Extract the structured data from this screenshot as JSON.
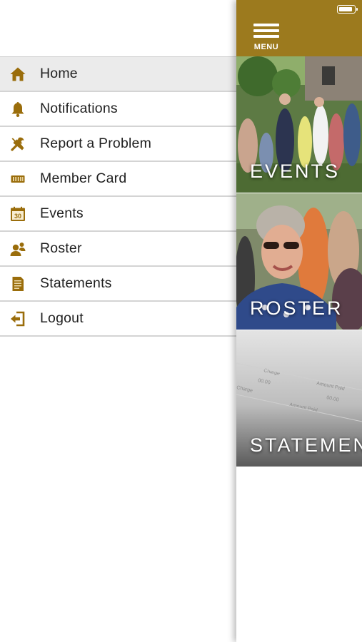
{
  "drawer": {
    "items": [
      {
        "label": "Home",
        "icon": "home-icon",
        "active": true
      },
      {
        "label": "Notifications",
        "icon": "bell-icon"
      },
      {
        "label": "Report a Problem",
        "icon": "tools-icon"
      },
      {
        "label": "Member Card",
        "icon": "card-icon"
      },
      {
        "label": "Events",
        "icon": "calendar-icon",
        "calendar_day": "30"
      },
      {
        "label": "Roster",
        "icon": "people-icon"
      },
      {
        "label": "Statements",
        "icon": "document-icon"
      },
      {
        "label": "Logout",
        "icon": "logout-icon"
      }
    ]
  },
  "header": {
    "menu_label": "MENU",
    "color": "#9c7a1e"
  },
  "tiles": [
    {
      "label": "EVENTS"
    },
    {
      "label": "ROSTER"
    },
    {
      "label": "STATEMEN"
    }
  ],
  "statement_photo_text": [
    "Charge",
    "Amount Paid",
    "Charge",
    "Amount Paid",
    "00.00",
    "00.00"
  ],
  "colors": {
    "accent": "#9c7a1e",
    "icon": "#9a6d0b",
    "active_row": "#ebebeb"
  }
}
